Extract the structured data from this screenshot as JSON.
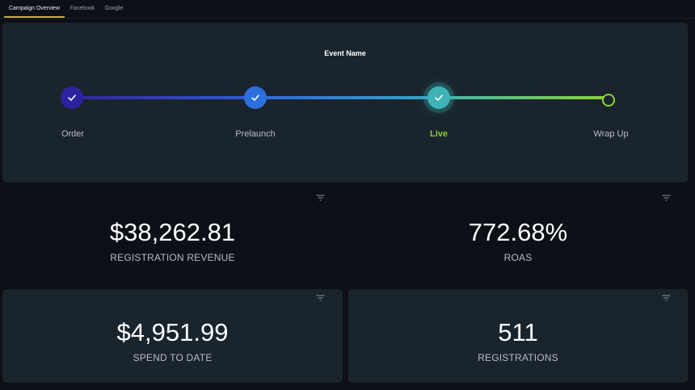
{
  "tabs": [
    {
      "label": "Campaign Overview",
      "active": true
    },
    {
      "label": "Facebook",
      "active": false
    },
    {
      "label": "Google",
      "active": false
    }
  ],
  "progress": {
    "title": "Event Name",
    "stages": [
      {
        "label": "Order",
        "status": "complete"
      },
      {
        "label": "Prelaunch",
        "status": "complete"
      },
      {
        "label": "Live",
        "status": "current"
      },
      {
        "label": "Wrap Up",
        "status": "upcoming"
      }
    ]
  },
  "kpis": [
    {
      "value": "$38,262.81",
      "label": "REGISTRATION REVENUE"
    },
    {
      "value": "772.68%",
      "label": "ROAS"
    },
    {
      "value": "$4,951.99",
      "label": "SPEND TO DATE"
    },
    {
      "value": "511",
      "label": "REGISTRATIONS"
    }
  ],
  "colors": {
    "background": "#0d1117",
    "panel": "#1a242d",
    "accent_tab": "#c9a84c",
    "live_green": "#8bd135"
  }
}
